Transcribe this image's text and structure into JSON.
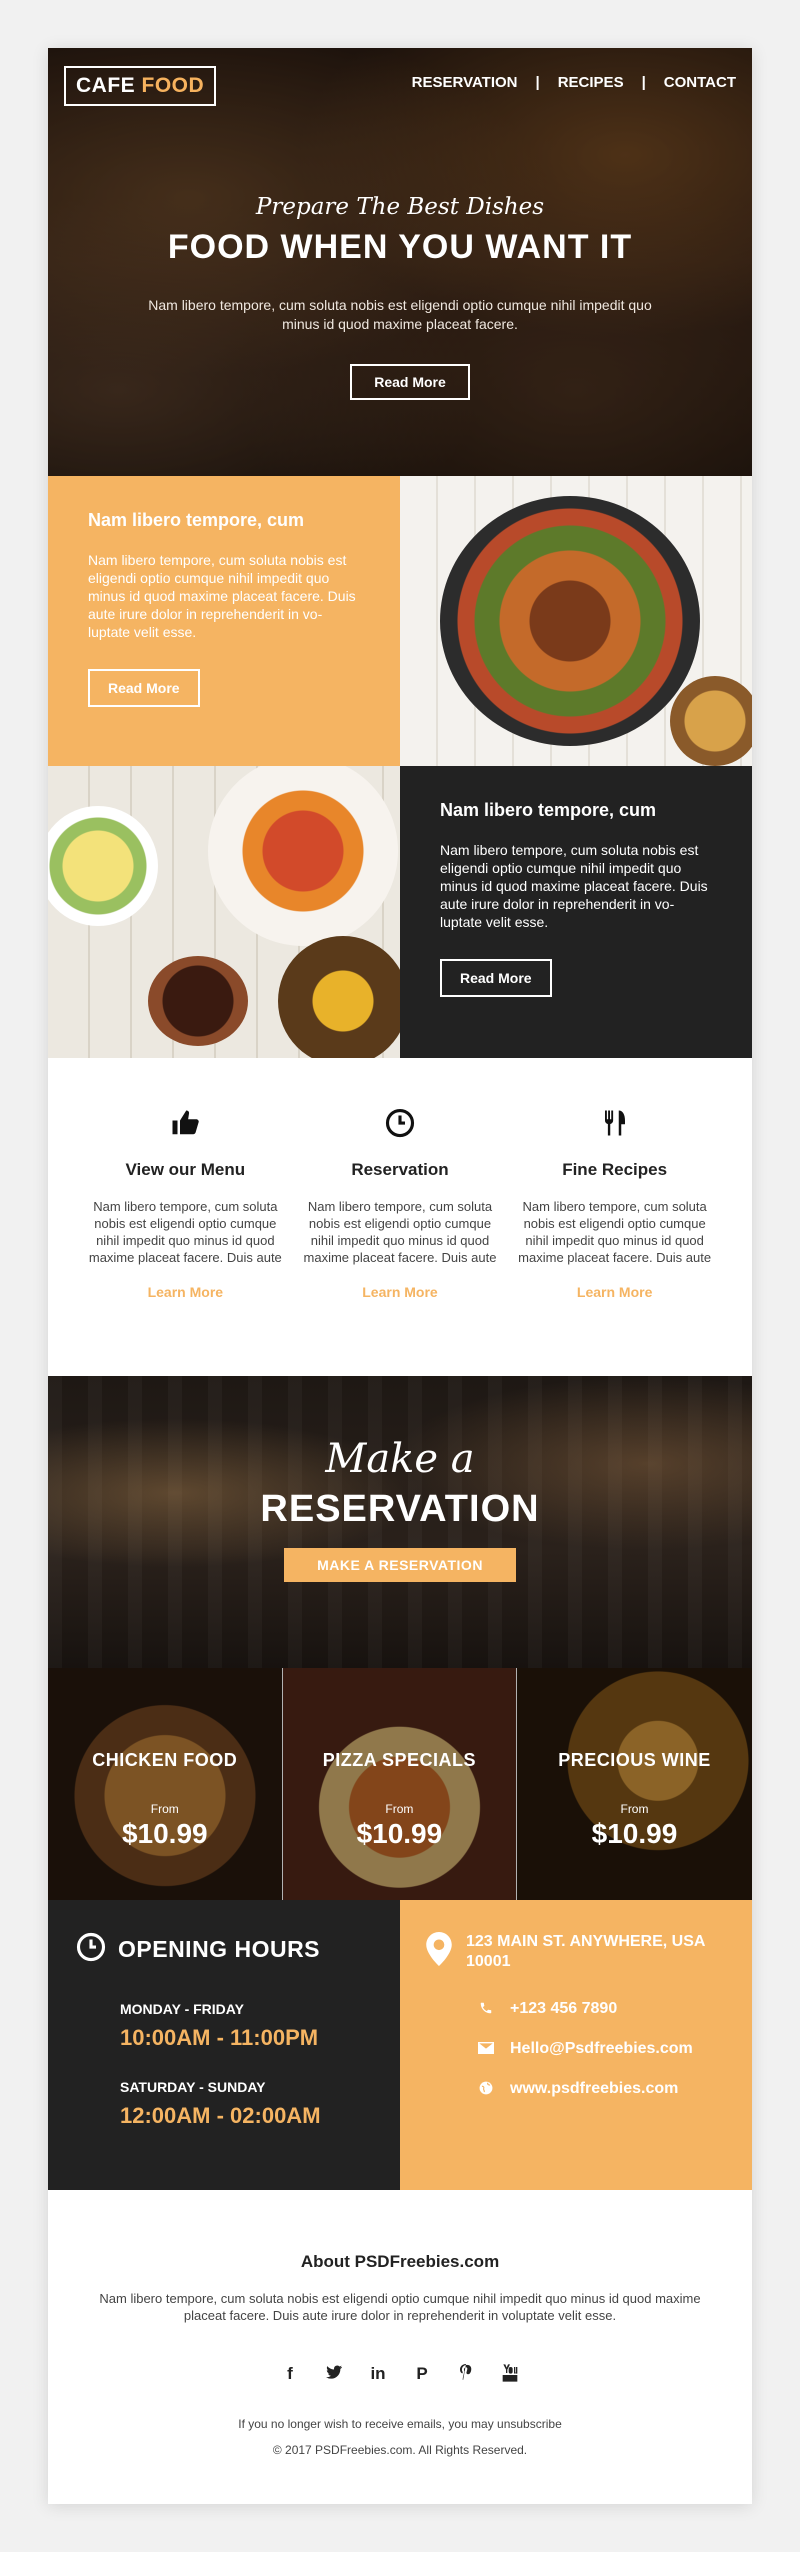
{
  "brand": {
    "logo_part1": "CAFE",
    "logo_part2": "FOOD",
    "accent_color": "#f5b462",
    "dark_color": "#222222"
  },
  "nav": {
    "items": [
      "RESERVATION",
      "RECIPES",
      "CONTACT"
    ],
    "separator": "|"
  },
  "hero": {
    "script": "Prepare The Best Dishes",
    "title": "FOOD WHEN YOU WANT IT",
    "text": "Nam libero tempore, cum soluta nobis est eligendi optio cumque nihil impedit quo minus id quod maxime placeat facere.",
    "button": "Read More"
  },
  "feature1": {
    "title": "Nam libero tempore, cum",
    "text": "Nam libero tempore, cum soluta nobis est eligendi optio cumque nihil impedit quo minus id quod maxime placeat facere. Duis aute irure dolor in reprehenderit in vo-luptate velit esse.",
    "button": "Read More"
  },
  "feature2": {
    "title": "Nam libero tempore, cum",
    "text": "Nam libero tempore, cum soluta nobis est eligendi optio cumque nihil impedit quo minus id quod maxime placeat facere. Duis aute irure dolor in reprehenderit in vo-luptate velit esse.",
    "button": "Read More"
  },
  "services": [
    {
      "icon": "thumbs-up-icon",
      "title": "View our Menu",
      "text": "Nam libero tempore, cum soluta nobis est eligendi optio cumque nihil impedit quo minus id quod maxime placeat facere. Duis aute",
      "link": "Learn More"
    },
    {
      "icon": "clock-icon",
      "title": "Reservation",
      "text": "Nam libero tempore, cum soluta nobis est eligendi optio cumque nihil impedit quo minus id quod maxime placeat facere. Duis aute",
      "link": "Learn More"
    },
    {
      "icon": "fork-knife-icon",
      "title": "Fine Recipes",
      "text": "Nam libero tempore, cum soluta nobis est eligendi optio cumque nihil impedit quo minus id quod maxime placeat facere. Duis aute",
      "link": "Learn More"
    }
  ],
  "reservation": {
    "script": "Make a",
    "title": "RESERVATION",
    "button": "MAKE A RESERVATION"
  },
  "specials": [
    {
      "name": "CHICKEN FOOD",
      "from": "From",
      "price": "$10.99"
    },
    {
      "name": "PIZZA SPECIALS",
      "from": "From",
      "price": "$10.99"
    },
    {
      "name": "PRECIOUS WINE",
      "from": "From",
      "price": "$10.99"
    }
  ],
  "hours": {
    "title": "OPENING HOURS",
    "weekday_label": "MONDAY - FRIDAY",
    "weekday_time": "10:00AM - 11:00PM",
    "weekend_label": "SATURDAY - SUNDAY",
    "weekend_time": "12:00AM - 02:00AM"
  },
  "contact": {
    "address": "123 MAIN ST. ANYWHERE, USA 10001",
    "phone": "+123 456 7890",
    "email": "Hello@Psdfreebies.com",
    "website": "www.psdfreebies.com"
  },
  "footer": {
    "title": "About PSDFreebies.com",
    "text": "Nam libero tempore, cum soluta nobis est eligendi optio cumque nihil impedit quo minus id quod maxime placeat facere. Duis aute irure dolor in reprehenderit in voluptate velit esse.",
    "socials": [
      "facebook-icon",
      "twitter-icon",
      "linkedin-icon",
      "paypal-icon",
      "pinterest-icon",
      "youtube-icon"
    ],
    "unsubscribe": "If you no longer wish to receive emails, you may unsubscribe",
    "copyright": "© 2017 PSDFreebies.com. All Rights Reserved."
  }
}
